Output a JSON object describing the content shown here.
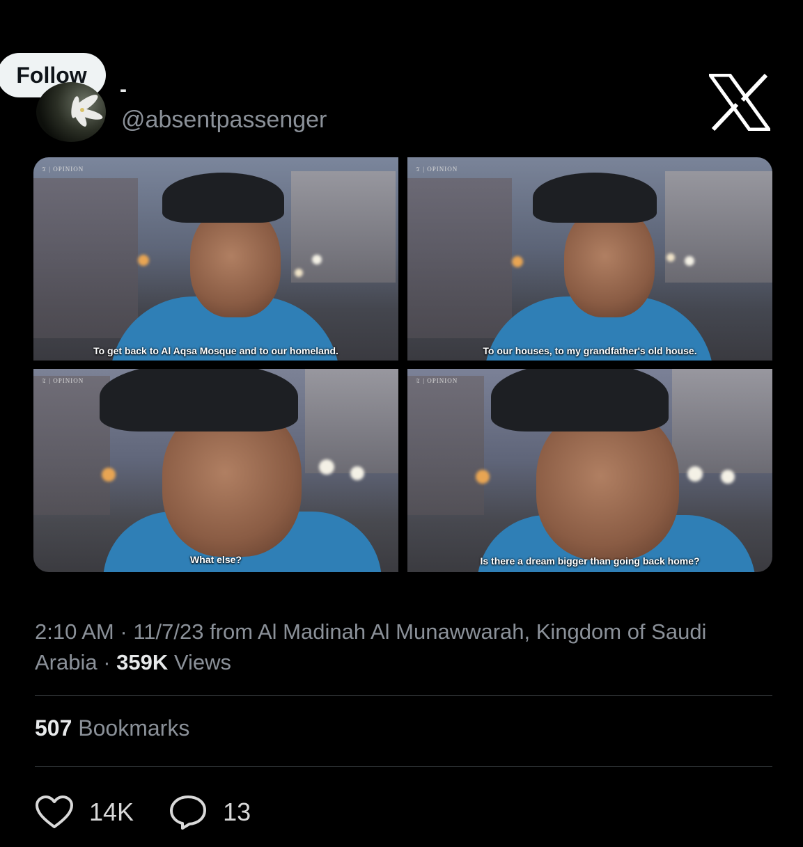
{
  "header": {
    "follow_label": "Follow",
    "display_name": "-",
    "handle": "@absentpassenger"
  },
  "media": {
    "frames": [
      {
        "brand": "OPINION",
        "caption": "To get back to Al Aqsa Mosque and to our homeland."
      },
      {
        "brand": "OPINION",
        "caption": "To our houses, to my grandfather's old house."
      },
      {
        "brand": "OPINION",
        "caption": "What else?"
      },
      {
        "brand": "OPINION",
        "caption": "Is there a dream bigger than going back home?"
      }
    ]
  },
  "meta": {
    "time": "2:10 AM",
    "separator": " · ",
    "date": "11/7/23",
    "location_prefix": " from Al Madinah Al Munawwarah, Kingdom of Saudi",
    "location_suffix": "Arabia",
    "views_count": "359K",
    "views_label": " Views"
  },
  "bookmarks": {
    "count": "507",
    "label": " Bookmarks"
  },
  "actions": {
    "likes": "14K",
    "replies": "13"
  },
  "colors": {
    "background": "#000000",
    "text": "#e7e9ea",
    "muted": "#8b9199",
    "divider": "#2f3336"
  }
}
